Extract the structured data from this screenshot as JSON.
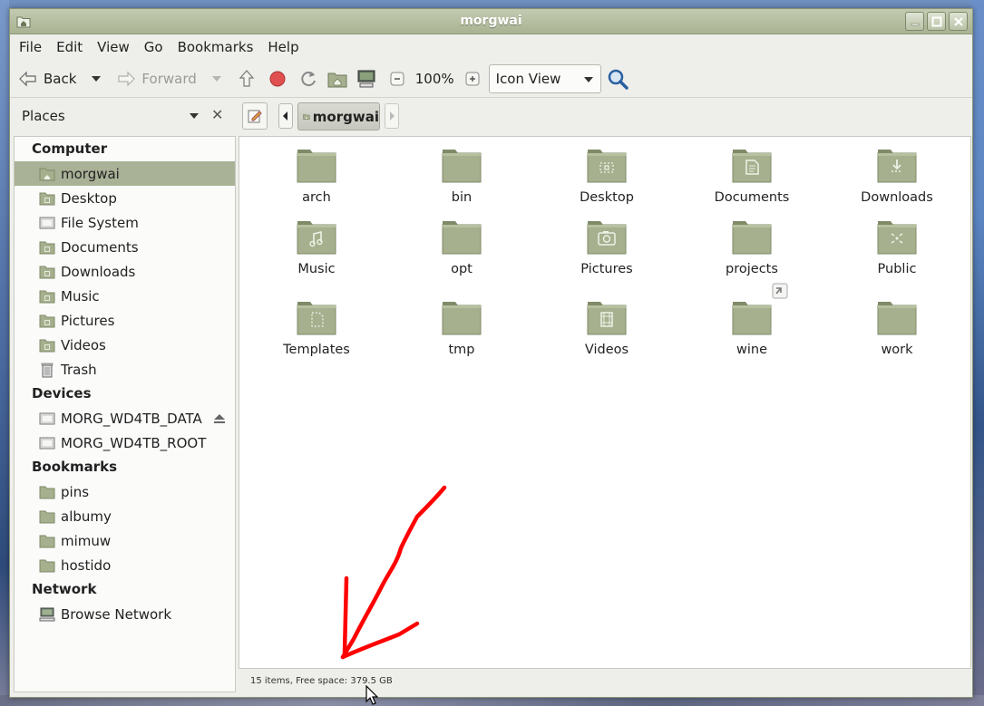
{
  "window": {
    "title": "morgwai"
  },
  "menubar": [
    "File",
    "Edit",
    "View",
    "Go",
    "Bookmarks",
    "Help"
  ],
  "toolbar": {
    "back": "Back",
    "forward": "Forward",
    "zoom": "100%",
    "view_mode": "Icon View"
  },
  "location": {
    "sidebar_mode": "Places",
    "current": "morgwai"
  },
  "sidebar": {
    "computer_heading": "Computer",
    "computer": [
      {
        "label": "morgwai",
        "icon": "home-folder-icon",
        "selected": true
      },
      {
        "label": "Desktop",
        "icon": "desktop-folder-icon"
      },
      {
        "label": "File System",
        "icon": "drive-icon"
      },
      {
        "label": "Documents",
        "icon": "documents-folder-icon"
      },
      {
        "label": "Downloads",
        "icon": "downloads-folder-icon"
      },
      {
        "label": "Music",
        "icon": "music-folder-icon"
      },
      {
        "label": "Pictures",
        "icon": "pictures-folder-icon"
      },
      {
        "label": "Videos",
        "icon": "videos-folder-icon"
      },
      {
        "label": "Trash",
        "icon": "trash-icon"
      }
    ],
    "devices_heading": "Devices",
    "devices": [
      {
        "label": "MORG_WD4TB_DATA",
        "icon": "drive-icon",
        "eject": true
      },
      {
        "label": "MORG_WD4TB_ROOT",
        "icon": "drive-icon"
      }
    ],
    "bookmarks_heading": "Bookmarks",
    "bookmarks": [
      {
        "label": "pins",
        "icon": "folder-icon"
      },
      {
        "label": "albumy",
        "icon": "folder-icon"
      },
      {
        "label": "mimuw",
        "icon": "folder-icon"
      },
      {
        "label": "hostido",
        "icon": "folder-icon"
      }
    ],
    "network_heading": "Network",
    "network": [
      {
        "label": "Browse Network",
        "icon": "network-icon"
      }
    ]
  },
  "files": [
    {
      "name": "arch",
      "emblem": ""
    },
    {
      "name": "bin",
      "emblem": ""
    },
    {
      "name": "Desktop",
      "emblem": "desktop"
    },
    {
      "name": "Documents",
      "emblem": "documents"
    },
    {
      "name": "Downloads",
      "emblem": "downloads"
    },
    {
      "name": "Music",
      "emblem": "music"
    },
    {
      "name": "opt",
      "emblem": ""
    },
    {
      "name": "Pictures",
      "emblem": "pictures"
    },
    {
      "name": "projects",
      "emblem": ""
    },
    {
      "name": "Public",
      "emblem": "public"
    },
    {
      "name": "Templates",
      "emblem": "templates"
    },
    {
      "name": "tmp",
      "emblem": ""
    },
    {
      "name": "Videos",
      "emblem": "videos"
    },
    {
      "name": "wine",
      "emblem": "symlink"
    },
    {
      "name": "work",
      "emblem": ""
    }
  ],
  "status": "15 items, Free space: 379.5 GB",
  "colors": {
    "folder": "#a6b08e",
    "folder_dark": "#7f8a68",
    "selection": "#a9b196",
    "annotation": "#ff0000"
  }
}
